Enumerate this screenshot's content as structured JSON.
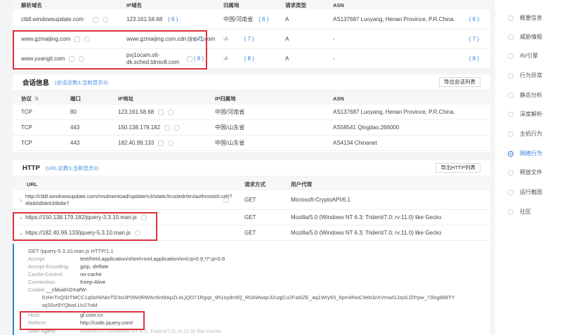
{
  "domain_table": {
    "headers": [
      "解析域名",
      "IP域名",
      "归属地",
      "请求类型",
      "ASN"
    ],
    "rows": [
      {
        "domain": "ctldl.windowsupdate.com",
        "ip": "123.161.58.68",
        "ip_count": "( 6 )",
        "location": "中国/河南省",
        "loc_count": "( 6 )",
        "type": "A",
        "asn": "AS137687 Luoyang, Henan Province, P.R.China.",
        "asn_count": "( 6 )"
      },
      {
        "domain": "www.gzmaijing.com",
        "ip": "www.gzmaijing.com.cdn.dnsv1.com.cn",
        "ip_count": "( 7 )",
        "location": "-/-",
        "loc_count": "( 7 )",
        "type": "A",
        "asn": "-",
        "asn_count": "( 7 )"
      },
      {
        "domain": "www.yuangit.com",
        "ip": "pvj1ocam.slt-dk.sched.tdnsv8.com",
        "ip_count": "( 8 )",
        "location": "-/-",
        "loc_count": "( 8 )",
        "type": "A",
        "asn": "-",
        "asn_count": "( 8 )"
      }
    ]
  },
  "session": {
    "title": "会话信息",
    "subtitle": "(会话总数3,当前显示3)",
    "export_label": "导出会话列表",
    "headers": [
      "协议",
      "端口",
      "IP地址",
      "IP归属地",
      "ASN"
    ],
    "rows": [
      {
        "protocol": "TCP",
        "port": "80",
        "ip": "123.161.58.68",
        "location": "中国/河南省",
        "asn": "AS137687 Luoyang, Henan Province, P.R.China."
      },
      {
        "protocol": "TCP",
        "port": "443",
        "ip": "150.138.179.182",
        "location": "中国/山东省",
        "asn": "AS58541 Qingdao,266000"
      },
      {
        "protocol": "TCP",
        "port": "443",
        "ip": "182.40.99.133",
        "location": "中国/山东省",
        "asn": "AS4134 Chinanet"
      }
    ]
  },
  "http": {
    "title": "HTTP",
    "subtitle": "(URL总数3,当前显示3)",
    "export_label": "导出HTTP列表",
    "headers": [
      "URL",
      "请求方式",
      "用户代理"
    ],
    "rows": [
      {
        "url": "http://ctldl.windowsupdate.com/msdownload/update/v3/static/trustedr/en/authrootstl.cab?4fa90dfde639b8e7",
        "method": "GET",
        "agent": "Microsoft-CryptoAPI/6.1"
      },
      {
        "url": "https://150.138.179.182/jquery-3.3.10.man.js",
        "method": "GET",
        "agent": "Mozilla/5.0 (Windows NT 6.3; Trident/7.0; rv:11.0) like Gecko"
      },
      {
        "url": "https://182.40.99.133/jquery-5.3.10.man.js",
        "method": "GET",
        "agent": "Mozilla/5.0 (Windows NT 6.3; Trident/7.0; rv:11.0) like Gecko"
      }
    ],
    "detail": {
      "request_line": "GET /jquery-5.3.10.man.js HTTP/1.1",
      "headers": [
        {
          "key": "Accept:",
          "value": "text/html,application/xhtml+xml,application/xml;q=0.9,*/*;q=0.8"
        },
        {
          "key": "Accept-Encoding:",
          "value": "gzip, deflate"
        },
        {
          "key": "Cache-Control:",
          "value": "no-cache"
        },
        {
          "key": "Connection:",
          "value": "Keep-Alive"
        },
        {
          "key": "Cookie:",
          "value": "__cfduid=DXafW-"
        }
      ],
      "cookie_cont1": "fUHnTxQIDTMCC1q0oh6NioTfZ4o3P0W0RWAn5nt9ApZLeLjQD71Rgqz_9h1oydn9Q_R0AWwqc32uqjCu2Fa6iZE_aq1Wry93_9pmithIoC9eb3zXVmwGJzpILfZPpw_73lxg889TY",
      "cookie_cont2": "wjS0vt9YQkwLUx27oM",
      "host_key": "Host:",
      "host_value": "gf.com.cn",
      "referer_key": "Referer:",
      "referer_value": "http://code.jquery.com/",
      "ua_key": "User-Agent:",
      "ua_value": "Mozilla/5.0 (Windows NT 6.3; Trident/7.0; rv:11.0) like Gecko"
    }
  },
  "sidebar": {
    "items": [
      "概要信息",
      "威胁情报",
      "AV引擎",
      "行为异常",
      "静态分析",
      "深度解析",
      "主机行为",
      "网络行为",
      "释放文件",
      "运行截图",
      "社区"
    ],
    "active_index": 7
  },
  "colors": {
    "accent": "#2f7fd8",
    "highlight": "#e0303e"
  }
}
